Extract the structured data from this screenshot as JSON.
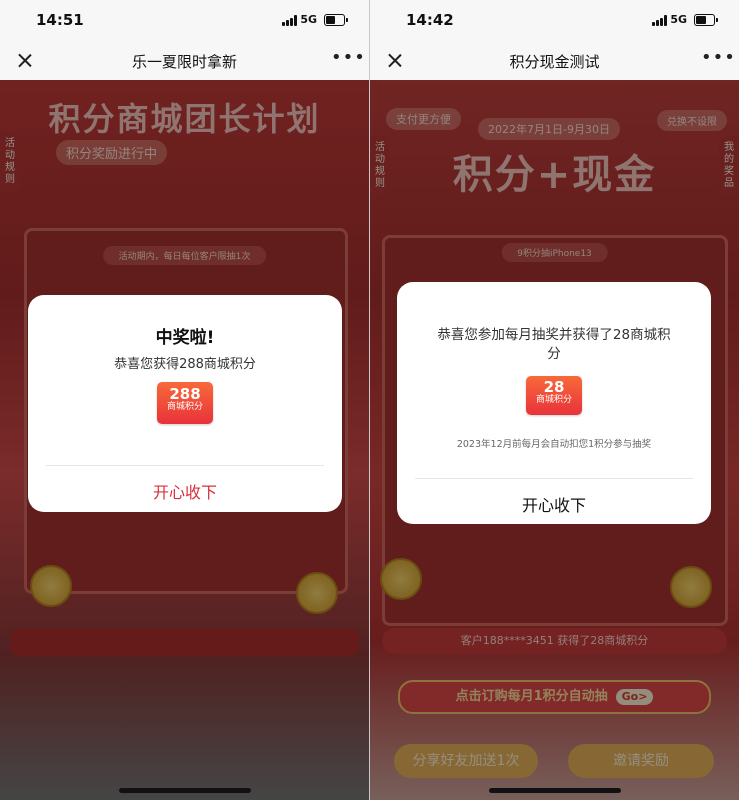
{
  "left": {
    "status": {
      "time": "14:51",
      "network": "5G"
    },
    "nav": {
      "title": "乐一夏限时拿新"
    },
    "banner": {
      "title": "积分商城团长计划",
      "subtitle": "积分奖励进行中",
      "side_tab": "活动规则",
      "notice": "活动期内，每日每位客户限抽1次"
    },
    "modal": {
      "title": "中奖啦!",
      "text": "恭喜您获得288商城积分",
      "coupon_value": "288",
      "coupon_unit": "商城积分",
      "button": "开心收下"
    }
  },
  "right": {
    "status": {
      "time": "14:42",
      "network": "5G"
    },
    "nav": {
      "title": "积分现金测试"
    },
    "banner": {
      "tag_left": "支付更方便",
      "tag_right": "兑换不设限",
      "date": "2022年7月1日-9月30日",
      "title": "积分+现金",
      "side_tab_left": "活动规则",
      "side_tab_right": "我的奖品",
      "notice": "9积分抽iPhone13"
    },
    "modal": {
      "text": "恭喜您参加每月抽奖并获得了28商城积分",
      "coupon_value": "28",
      "coupon_unit": "商城积分",
      "sub": "2023年12月前每月会自动扣您1积分参与抽奖",
      "button": "开心收下"
    },
    "winner_text": "客户188****3451 获得了28商城积分",
    "cta": {
      "label": "点击订购每月1积分自动抽",
      "go": "Go>"
    },
    "share_button": "分享好友加送1次",
    "invite_button": "邀请奖励"
  },
  "colors": {
    "accent_red": "#d9303a",
    "coupon_orange": "#f86a3a",
    "gold": "#e9b15a"
  }
}
